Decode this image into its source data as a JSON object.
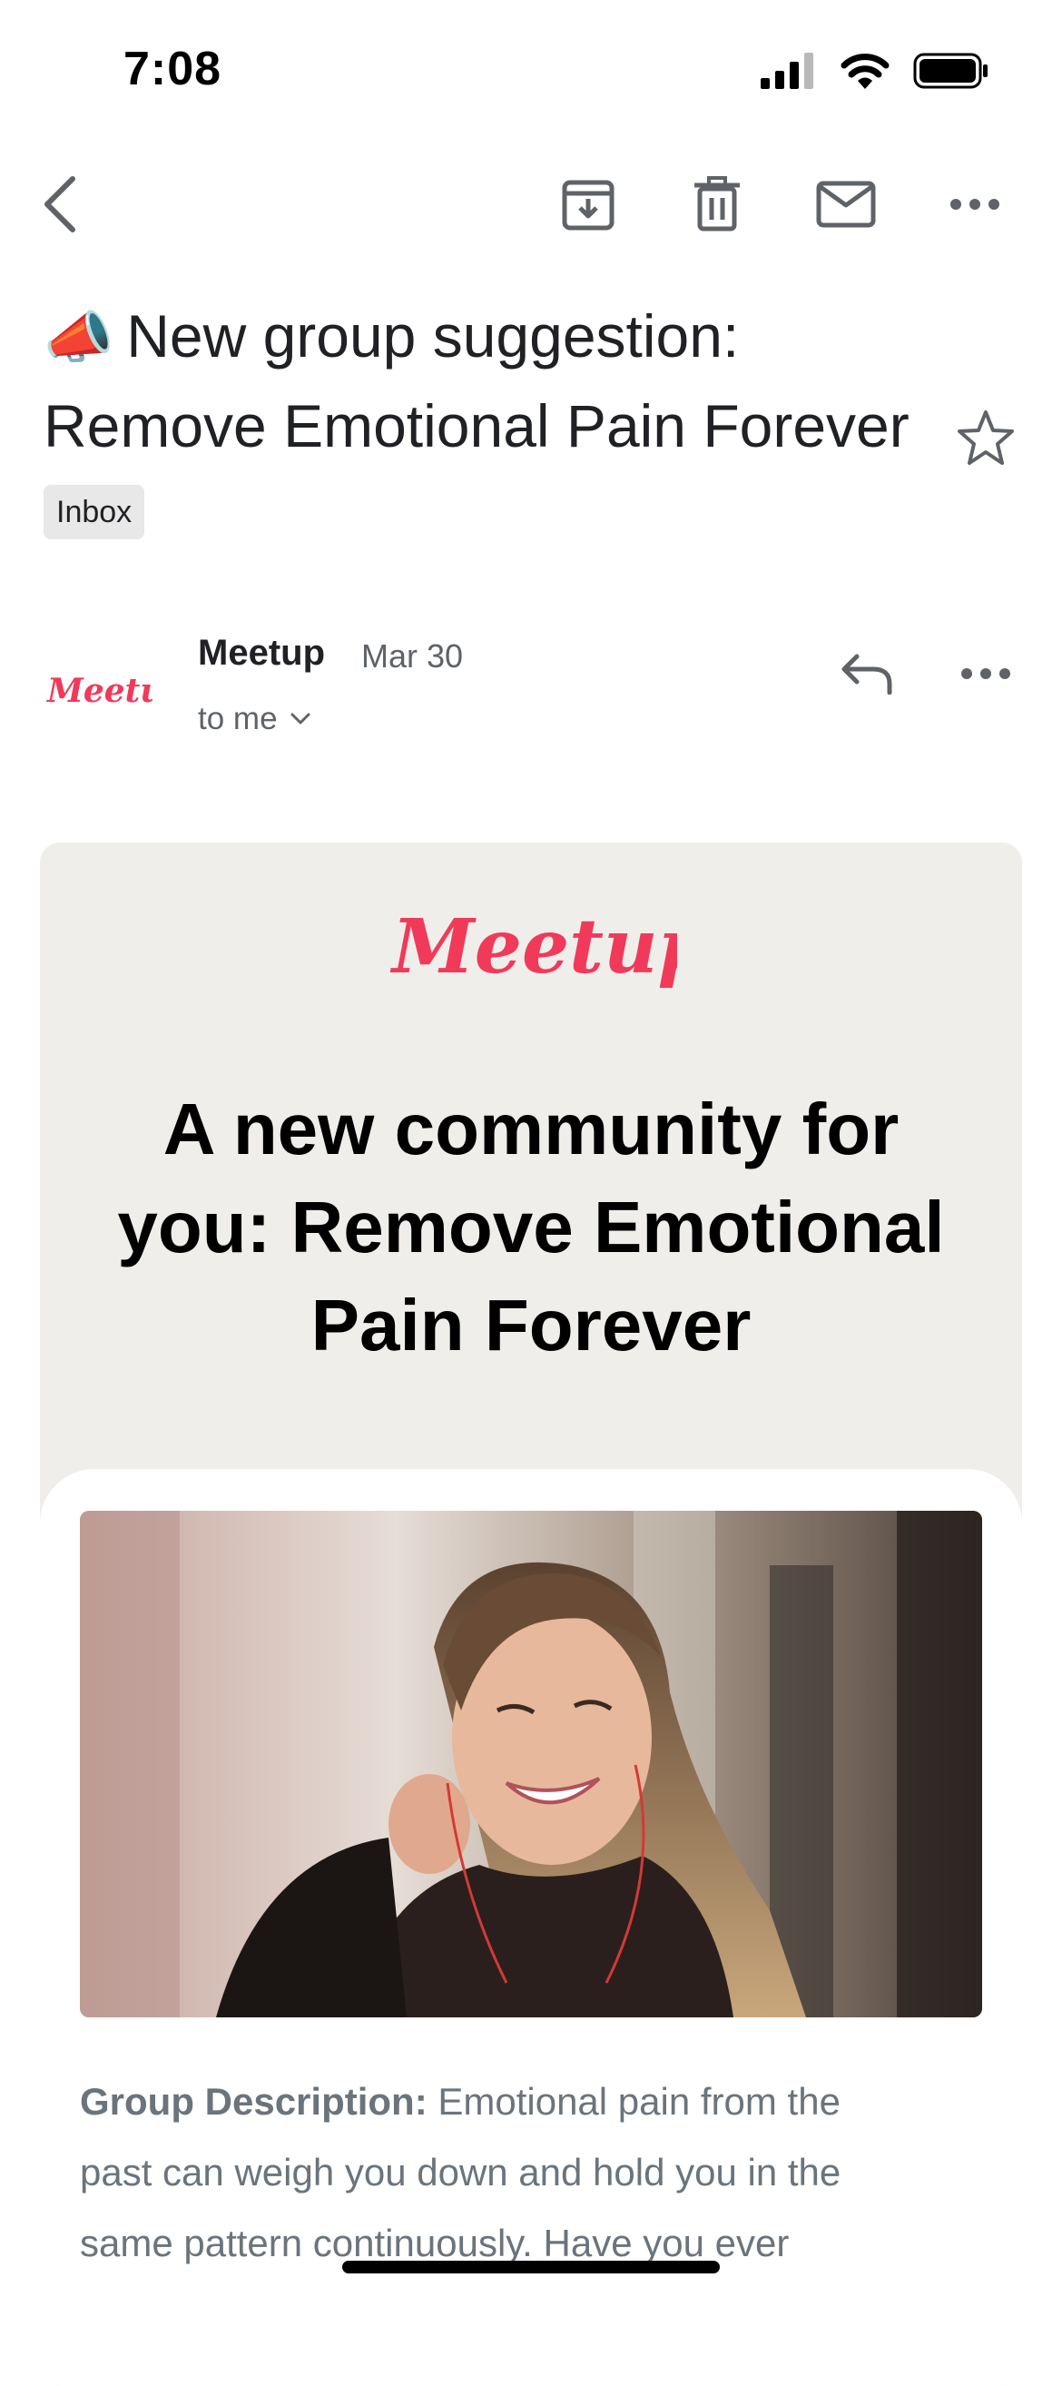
{
  "status_bar": {
    "time": "7:08"
  },
  "toolbar": {
    "back_icon": "chevron-left-icon",
    "archive_icon": "archive-icon",
    "delete_icon": "trash-icon",
    "mark_unread_icon": "envelope-icon",
    "more_icon": "more-horizontal-icon"
  },
  "email": {
    "subject_emoji": "📣",
    "subject_line1": "New group suggestion:",
    "subject_line2": "Remove Emotional Pain Forever",
    "label": "Inbox",
    "sender": "Meetup",
    "date": "Mar 30",
    "recipient": "to me",
    "avatar_text": "Meetup"
  },
  "body": {
    "logo_text": "Meetup",
    "headline_line1": "A new community for",
    "headline_line2": "you: Remove Emotional",
    "headline_line3": "Pain Forever",
    "description_label": "Group Description:",
    "description_line1": "Emotional pain from the",
    "description_line2": "past can weigh you down and hold you in the",
    "description_line3": "same pattern continuously. Have you ever"
  },
  "colors": {
    "brand": "#f13a59",
    "card_background": "#f0eeea",
    "description_text": "#6b747c"
  }
}
